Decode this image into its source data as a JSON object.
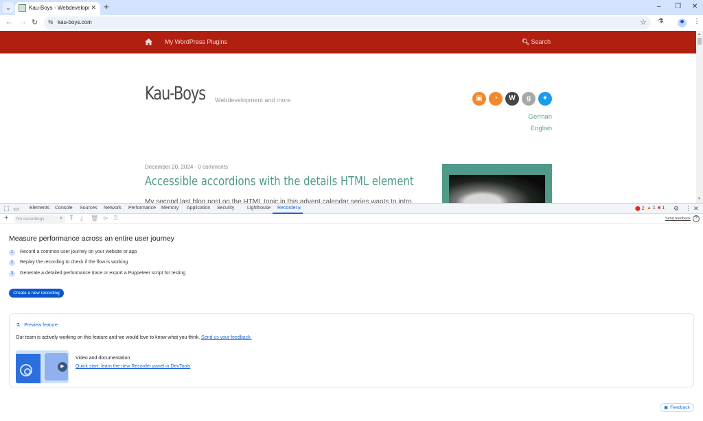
{
  "browser": {
    "tab_title": "Kau-Boys - Webdevelopment and more",
    "tab_close": "✕",
    "new_tab": "+",
    "url": "kau-boys.com",
    "window": {
      "minimize": "–",
      "restore": "❐",
      "close": "✕"
    },
    "nav": {
      "back": "←",
      "forward": "→",
      "reload": "↻"
    }
  },
  "site": {
    "nav": {
      "home_icon": "home-icon",
      "menu_items": [
        "My WordPress Plugins"
      ],
      "search_label": "Search"
    },
    "title": "Kau-Boys",
    "description": "Webdevelopment and more",
    "social_icons": [
      {
        "name": "comments-feed",
        "glyph": "▣",
        "color": "#f0892e"
      },
      {
        "name": "rss-feed",
        "glyph": "◔",
        "color": "#f0892e"
      },
      {
        "name": "wordpress",
        "glyph": "W",
        "color": "#464646"
      },
      {
        "name": "google",
        "glyph": "g",
        "color": "#a8a8a8"
      },
      {
        "name": "twitter",
        "glyph": "✦",
        "color": "#1c9be8"
      }
    ],
    "languages": [
      "German",
      "English"
    ],
    "post": {
      "date": "December 20, 2024",
      "separator": "·",
      "comments": "0 comments",
      "title": "Accessible accordions with the details HTML element",
      "excerpt": "My second last blog post on the HTML topic in this advent calendar series wants to intro"
    }
  },
  "devtools": {
    "tabs": [
      "Elements",
      "Console",
      "Sources",
      "Network",
      "Performance",
      "Memory",
      "Application",
      "Security",
      "Lighthouse",
      "Recorder"
    ],
    "active_tab": "Recorder",
    "status": {
      "errors": "2",
      "warnings": "1",
      "issues": "1"
    },
    "toolbar": {
      "recordings_placeholder": "No recordings",
      "send_feedback": "Send feedback"
    },
    "recorder": {
      "heading": "Measure performance across an entire user journey",
      "steps": [
        {
          "num": "1",
          "text": "Record a common user journey on your website or app"
        },
        {
          "num": "2",
          "text": "Replay the recording to check if the flow is working"
        },
        {
          "num": "3",
          "text": "Generate a detailed performance trace or export a Puppeteer script for testing"
        }
      ],
      "create_button": "Create a new recording",
      "preview": {
        "label": "Preview feature",
        "text": "Our team is actively working on this feature and we would love to know what you think.",
        "feedback_link": "Send us your feedback.",
        "video_title": "Video and documentation",
        "video_link": "Quick start: learn the new Recorder panel in DevTools"
      },
      "feedback_button": "Feedback"
    }
  },
  "colors": {
    "site_nav_bg": "#b01f10",
    "site_accent": "#4e9a8a",
    "devtools_accent": "#1a63d4",
    "primary_button": "#0b57d0"
  }
}
